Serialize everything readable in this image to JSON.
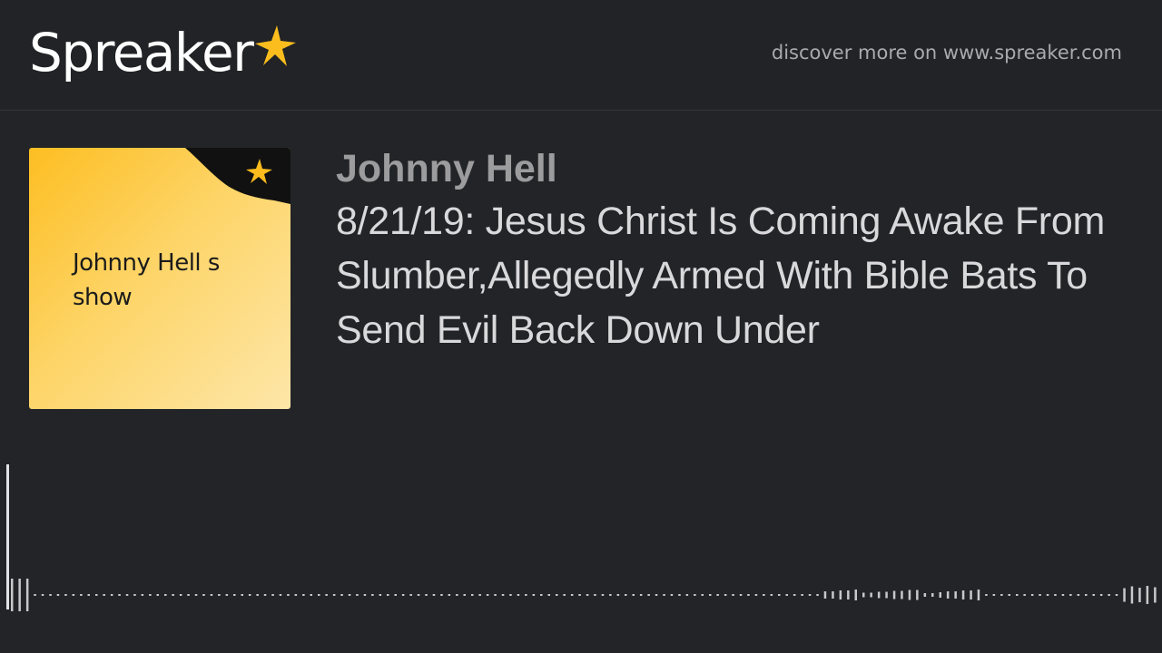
{
  "header": {
    "logo_text": "Spreaker",
    "logo_star_color": "#fbbd1d",
    "discover_text": "discover more on www.spreaker.com"
  },
  "podcast": {
    "cover_title": "Johnny Hell s show",
    "author": "Johnny Hell",
    "episode_title": "8/21/19: Jesus Christ Is Coming Awake From Slumber,Allegedly Armed With Bible Bats To Send Evil Back Down Under"
  },
  "player": {
    "progress": 0.0
  },
  "colors": {
    "background": "#232428",
    "accent": "#fbbd1d",
    "title_text": "#d9d9db",
    "author_text": "#9c9c9e",
    "waveform": "#c8c8ca"
  }
}
